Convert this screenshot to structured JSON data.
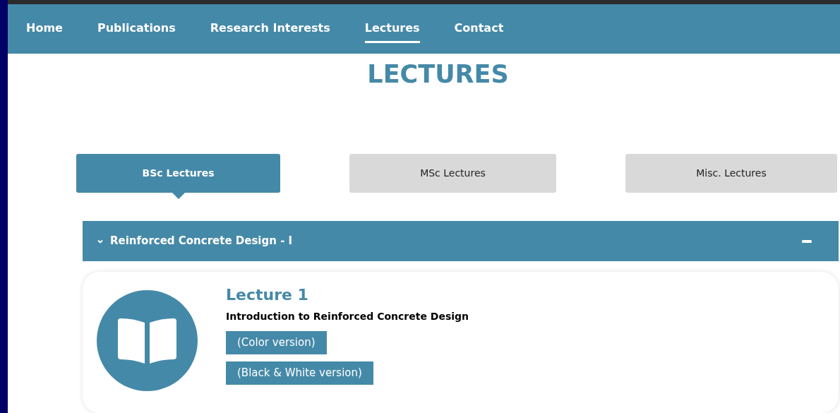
{
  "nav": [
    {
      "label": "Home",
      "selected": false
    },
    {
      "label": "Publications",
      "selected": false
    },
    {
      "label": "Research Interests",
      "selected": false
    },
    {
      "label": "Lectures",
      "selected": true
    },
    {
      "label": "Contact",
      "selected": false
    }
  ],
  "heading": "LECTURES",
  "tabs": [
    {
      "label": "BSc Lectures",
      "selected": true
    },
    {
      "label": "MSc Lectures",
      "selected": false
    },
    {
      "label": "Misc. Lectures",
      "selected": false
    }
  ],
  "accordion": {
    "title": "Reinforced Concrete Design - I",
    "expanded": true,
    "lectures": [
      {
        "title": "Lecture 1",
        "subtitle": "Introduction to Reinforced Concrete Design",
        "links": [
          "(Color version)",
          "(Black & White version)"
        ]
      }
    ]
  }
}
